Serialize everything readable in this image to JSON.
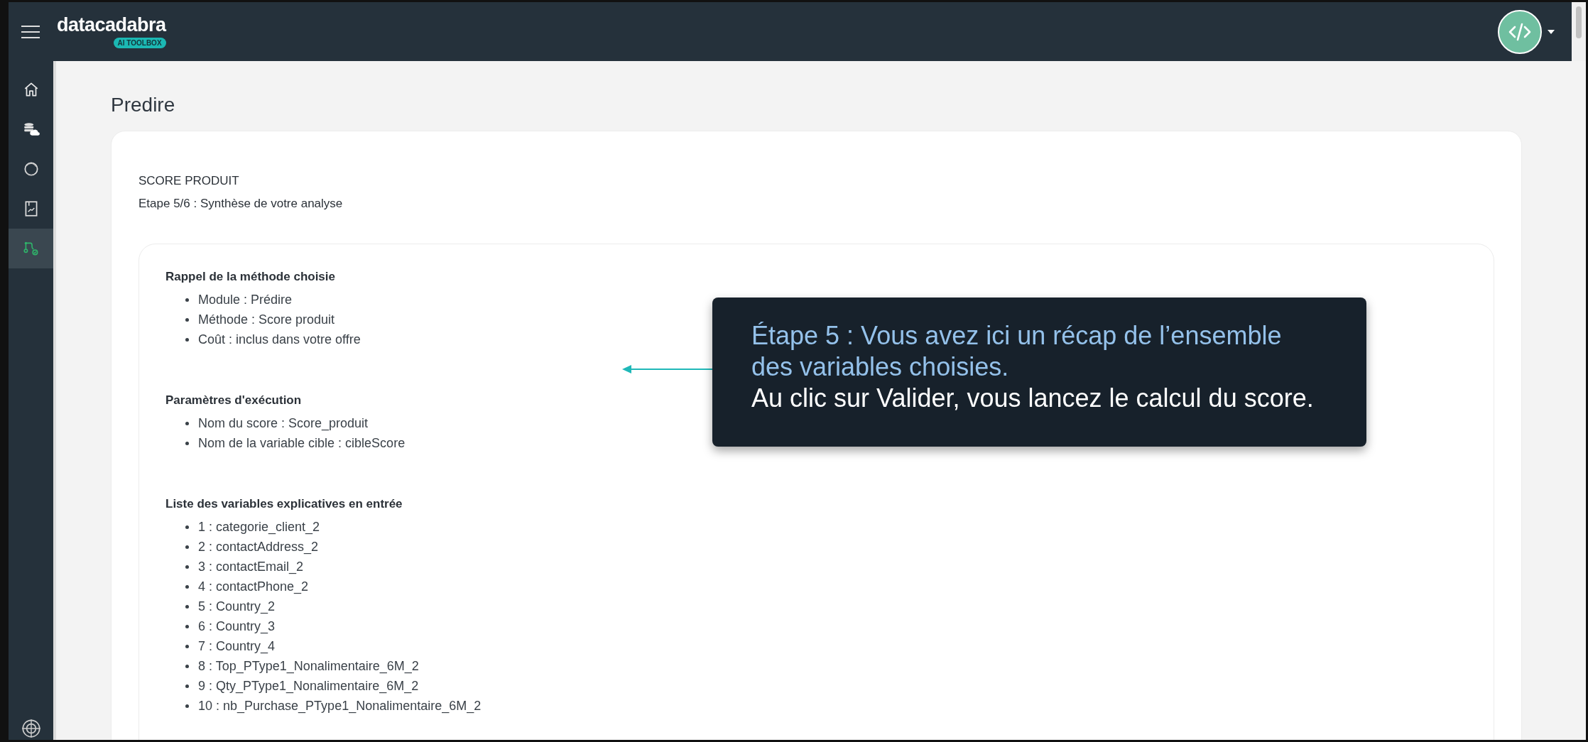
{
  "header": {
    "logo": "datacadabra",
    "badge": "AI TOOLBOX"
  },
  "sidebar": {
    "items": [
      {
        "kind": "home",
        "selected": false
      },
      {
        "kind": "data",
        "selected": false
      },
      {
        "kind": "cycle",
        "selected": false
      },
      {
        "kind": "report",
        "selected": false
      },
      {
        "kind": "flow",
        "selected": true
      }
    ]
  },
  "page": {
    "title": "Predire",
    "module": "SCORE PRODUIT",
    "step": "Etape 5/6 : Synthèse de votre analyse",
    "sections": [
      {
        "title": "Rappel de la méthode choisie",
        "items": [
          "Module : Prédire",
          "Méthode : Score produit",
          "Coût : inclus dans votre offre"
        ]
      },
      {
        "title": "Paramètres d'exécution",
        "items": [
          "Nom du score : Score_produit",
          "Nom de la variable cible : cibleScore"
        ]
      },
      {
        "title": "Liste des variables explicatives en entrée",
        "items": [
          "1 : categorie_client_2",
          "2 : contactAddress_2",
          "3 : contactEmail_2",
          "4 : contactPhone_2",
          "5 : Country_2",
          "6 : Country_3",
          "7 : Country_4",
          "8 : Top_PType1_Nonalimentaire_6M_2",
          "9 : Qty_PType1_Nonalimentaire_6M_2",
          "10 : nb_Purchase_PType1_Nonalimentaire_6M_2"
        ]
      }
    ]
  },
  "tooltip": {
    "highlight": "Étape 5 : Vous avez ici un récap de l’ensemble des variables choisies.",
    "text": "Au clic sur Valider, vous lancez le calcul du score."
  }
}
